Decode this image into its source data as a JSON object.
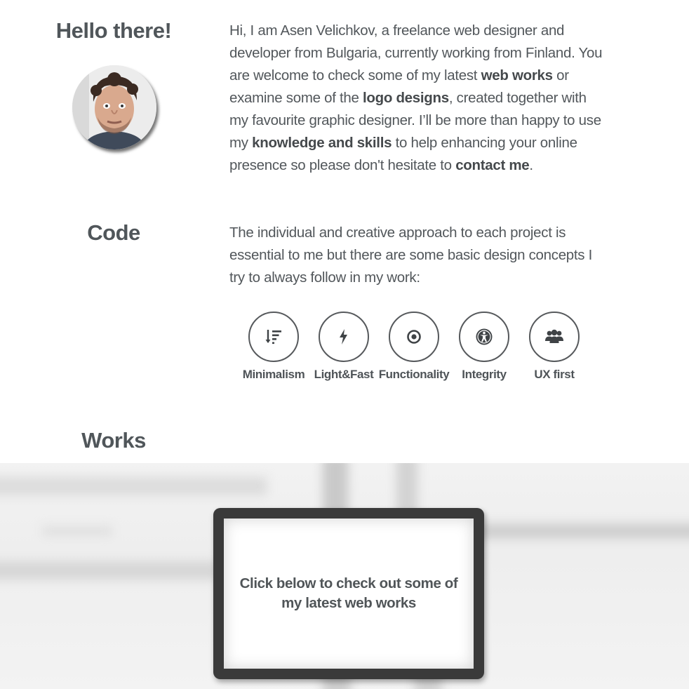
{
  "about": {
    "heading": "Hello there!",
    "intro_parts": [
      "Hi, I am Asen Velichkov, a freelance web designer and developer from Bulgaria, currently working from Finland. You are welcome to check some of my latest ",
      "web works",
      " or examine some of the ",
      "logo designs",
      ", created together with my favourite graphic designer. I’ll be more than happy to use my ",
      "knowledge and skills",
      " to help enhancing your online presence so please don't hesitate to ",
      "contact me",
      "."
    ],
    "avatar_alt": "avatar"
  },
  "code": {
    "heading": "Code",
    "text": "The individual and creative approach to each project is essential to me but there are some basic design concepts I try to always follow in my work:",
    "concepts": [
      {
        "label": "Minimalism",
        "icon": "sort-down-icon"
      },
      {
        "label": "Light&Fast",
        "icon": "bolt-icon"
      },
      {
        "label": "Functionality",
        "icon": "dot-circle-icon"
      },
      {
        "label": "Integrity",
        "icon": "universal-access-icon"
      },
      {
        "label": "UX first",
        "icon": "users-icon"
      }
    ]
  },
  "works": {
    "heading": "Works",
    "screen_text": "Click below to check out some of my latest web works"
  },
  "colors": {
    "text": "#52575b",
    "heading": "#50565a",
    "frame": "#3a3a3a"
  }
}
